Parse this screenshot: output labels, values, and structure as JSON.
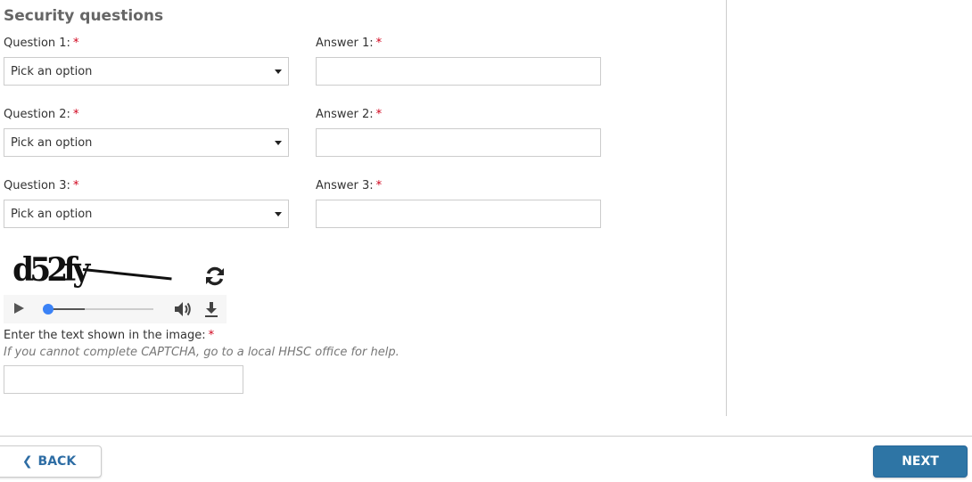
{
  "section": {
    "title": "Security questions"
  },
  "required_marker": "*",
  "questions": [
    {
      "label": "Question 1:",
      "select_value": "Pick an option",
      "answer_label": "Answer 1:",
      "answer_value": ""
    },
    {
      "label": "Question 2:",
      "select_value": "Pick an option",
      "answer_label": "Answer 2:",
      "answer_value": ""
    },
    {
      "label": "Question 3:",
      "select_value": "Pick an option",
      "answer_label": "Answer 3:",
      "answer_value": ""
    }
  ],
  "captcha": {
    "image_text": "d52fy",
    "audio": {
      "progress": 0.0,
      "buffered": 0.35
    },
    "label": "Enter the text shown in the image:",
    "help": "If you cannot complete CAPTCHA, go to a local HHSC office for help.",
    "input_value": ""
  },
  "footer": {
    "back_label": "BACK",
    "next_label": "NEXT"
  },
  "colors": {
    "primary": "#2e75a5",
    "required": "#d0021b",
    "audio_thumb": "#3b82f6"
  }
}
